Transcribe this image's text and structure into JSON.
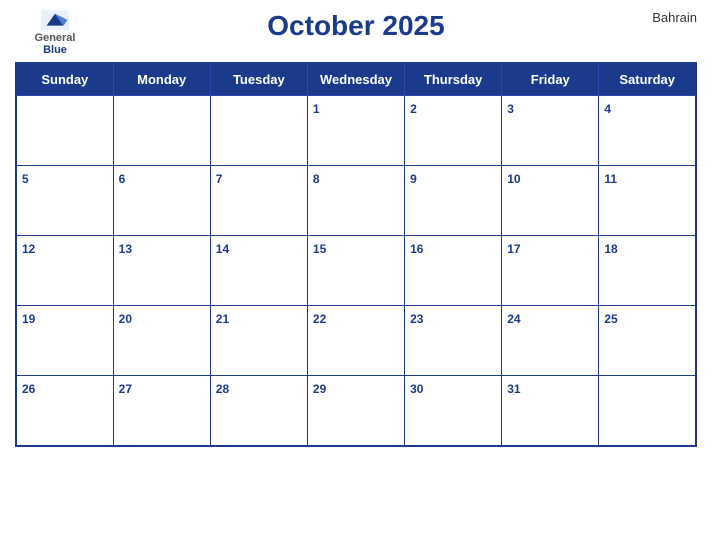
{
  "header": {
    "logo": {
      "general": "General",
      "blue": "Blue"
    },
    "title": "October 2025",
    "country": "Bahrain"
  },
  "weekdays": [
    "Sunday",
    "Monday",
    "Tuesday",
    "Wednesday",
    "Thursday",
    "Friday",
    "Saturday"
  ],
  "weeks": [
    [
      null,
      null,
      null,
      1,
      2,
      3,
      4
    ],
    [
      5,
      6,
      7,
      8,
      9,
      10,
      11
    ],
    [
      12,
      13,
      14,
      15,
      16,
      17,
      18
    ],
    [
      19,
      20,
      21,
      22,
      23,
      24,
      25
    ],
    [
      26,
      27,
      28,
      29,
      30,
      31,
      null
    ]
  ]
}
